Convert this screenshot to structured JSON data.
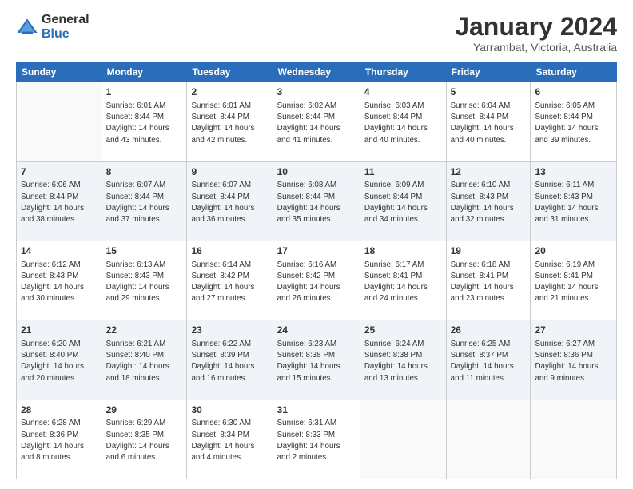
{
  "header": {
    "logo_general": "General",
    "logo_blue": "Blue",
    "month_title": "January 2024",
    "location": "Yarrambat, Victoria, Australia"
  },
  "days_of_week": [
    "Sunday",
    "Monday",
    "Tuesday",
    "Wednesday",
    "Thursday",
    "Friday",
    "Saturday"
  ],
  "weeks": [
    [
      {
        "day": "",
        "info": ""
      },
      {
        "day": "1",
        "info": "Sunrise: 6:01 AM\nSunset: 8:44 PM\nDaylight: 14 hours\nand 43 minutes."
      },
      {
        "day": "2",
        "info": "Sunrise: 6:01 AM\nSunset: 8:44 PM\nDaylight: 14 hours\nand 42 minutes."
      },
      {
        "day": "3",
        "info": "Sunrise: 6:02 AM\nSunset: 8:44 PM\nDaylight: 14 hours\nand 41 minutes."
      },
      {
        "day": "4",
        "info": "Sunrise: 6:03 AM\nSunset: 8:44 PM\nDaylight: 14 hours\nand 40 minutes."
      },
      {
        "day": "5",
        "info": "Sunrise: 6:04 AM\nSunset: 8:44 PM\nDaylight: 14 hours\nand 40 minutes."
      },
      {
        "day": "6",
        "info": "Sunrise: 6:05 AM\nSunset: 8:44 PM\nDaylight: 14 hours\nand 39 minutes."
      }
    ],
    [
      {
        "day": "7",
        "info": "Sunrise: 6:06 AM\nSunset: 8:44 PM\nDaylight: 14 hours\nand 38 minutes."
      },
      {
        "day": "8",
        "info": "Sunrise: 6:07 AM\nSunset: 8:44 PM\nDaylight: 14 hours\nand 37 minutes."
      },
      {
        "day": "9",
        "info": "Sunrise: 6:07 AM\nSunset: 8:44 PM\nDaylight: 14 hours\nand 36 minutes."
      },
      {
        "day": "10",
        "info": "Sunrise: 6:08 AM\nSunset: 8:44 PM\nDaylight: 14 hours\nand 35 minutes."
      },
      {
        "day": "11",
        "info": "Sunrise: 6:09 AM\nSunset: 8:44 PM\nDaylight: 14 hours\nand 34 minutes."
      },
      {
        "day": "12",
        "info": "Sunrise: 6:10 AM\nSunset: 8:43 PM\nDaylight: 14 hours\nand 32 minutes."
      },
      {
        "day": "13",
        "info": "Sunrise: 6:11 AM\nSunset: 8:43 PM\nDaylight: 14 hours\nand 31 minutes."
      }
    ],
    [
      {
        "day": "14",
        "info": "Sunrise: 6:12 AM\nSunset: 8:43 PM\nDaylight: 14 hours\nand 30 minutes."
      },
      {
        "day": "15",
        "info": "Sunrise: 6:13 AM\nSunset: 8:43 PM\nDaylight: 14 hours\nand 29 minutes."
      },
      {
        "day": "16",
        "info": "Sunrise: 6:14 AM\nSunset: 8:42 PM\nDaylight: 14 hours\nand 27 minutes."
      },
      {
        "day": "17",
        "info": "Sunrise: 6:16 AM\nSunset: 8:42 PM\nDaylight: 14 hours\nand 26 minutes."
      },
      {
        "day": "18",
        "info": "Sunrise: 6:17 AM\nSunset: 8:41 PM\nDaylight: 14 hours\nand 24 minutes."
      },
      {
        "day": "19",
        "info": "Sunrise: 6:18 AM\nSunset: 8:41 PM\nDaylight: 14 hours\nand 23 minutes."
      },
      {
        "day": "20",
        "info": "Sunrise: 6:19 AM\nSunset: 8:41 PM\nDaylight: 14 hours\nand 21 minutes."
      }
    ],
    [
      {
        "day": "21",
        "info": "Sunrise: 6:20 AM\nSunset: 8:40 PM\nDaylight: 14 hours\nand 20 minutes."
      },
      {
        "day": "22",
        "info": "Sunrise: 6:21 AM\nSunset: 8:40 PM\nDaylight: 14 hours\nand 18 minutes."
      },
      {
        "day": "23",
        "info": "Sunrise: 6:22 AM\nSunset: 8:39 PM\nDaylight: 14 hours\nand 16 minutes."
      },
      {
        "day": "24",
        "info": "Sunrise: 6:23 AM\nSunset: 8:38 PM\nDaylight: 14 hours\nand 15 minutes."
      },
      {
        "day": "25",
        "info": "Sunrise: 6:24 AM\nSunset: 8:38 PM\nDaylight: 14 hours\nand 13 minutes."
      },
      {
        "day": "26",
        "info": "Sunrise: 6:25 AM\nSunset: 8:37 PM\nDaylight: 14 hours\nand 11 minutes."
      },
      {
        "day": "27",
        "info": "Sunrise: 6:27 AM\nSunset: 8:36 PM\nDaylight: 14 hours\nand 9 minutes."
      }
    ],
    [
      {
        "day": "28",
        "info": "Sunrise: 6:28 AM\nSunset: 8:36 PM\nDaylight: 14 hours\nand 8 minutes."
      },
      {
        "day": "29",
        "info": "Sunrise: 6:29 AM\nSunset: 8:35 PM\nDaylight: 14 hours\nand 6 minutes."
      },
      {
        "day": "30",
        "info": "Sunrise: 6:30 AM\nSunset: 8:34 PM\nDaylight: 14 hours\nand 4 minutes."
      },
      {
        "day": "31",
        "info": "Sunrise: 6:31 AM\nSunset: 8:33 PM\nDaylight: 14 hours\nand 2 minutes."
      },
      {
        "day": "",
        "info": ""
      },
      {
        "day": "",
        "info": ""
      },
      {
        "day": "",
        "info": ""
      }
    ]
  ]
}
